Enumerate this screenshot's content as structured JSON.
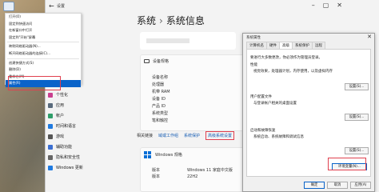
{
  "window": {
    "title": "设置"
  },
  "breadcrumb": {
    "parent": "系统",
    "separator": "›",
    "current": "系统信息"
  },
  "spec": {
    "heading": "设备规格",
    "rows": [
      "设备名称",
      "处理器",
      "机带 RAM",
      "设备 ID",
      "产品 ID",
      "系统类型",
      "笔和触控"
    ]
  },
  "related": {
    "label": "相关链接",
    "links": [
      "域或工作组",
      "系统保护",
      "高级系统设置"
    ]
  },
  "windows": {
    "heading": "Windows 规格",
    "rows": [
      {
        "key": "版本",
        "value": "Windows 11 家庭中文版"
      },
      {
        "key": "版本",
        "value": "22H2"
      }
    ]
  },
  "nav": {
    "items": [
      {
        "label": "个性化",
        "color": "#c9408f"
      },
      {
        "label": "应用",
        "color": "#5a6b7d"
      },
      {
        "label": "帐户",
        "color": "#2f9e6a"
      },
      {
        "label": "时间和语言",
        "color": "#1f7ae0"
      },
      {
        "label": "游戏",
        "color": "#555555"
      },
      {
        "label": "辅助功能",
        "color": "#3b6fd1"
      },
      {
        "label": "隐私和安全性",
        "color": "#666666"
      },
      {
        "label": "Windows 更新",
        "color": "#1f7ae0"
      }
    ]
  },
  "context_menu": {
    "items": [
      "打开(O)",
      "固定到快速访问",
      "在新窗口中打开",
      "固定到\"开始\"屏幕",
      "映射网络驱动器(N)...",
      "断开网络驱动器的连接(C)...",
      "创建快捷方式(S)",
      "删除(D)",
      "重命名(M)",
      "属性(R)"
    ],
    "selected_index": 9
  },
  "dialog": {
    "title": "系统属性",
    "close": "✕",
    "tabs": [
      "计算机名",
      "硬件",
      "高级",
      "系统保护",
      "远程"
    ],
    "active_tab": 2,
    "lines": [
      "要进行大多数更改，你必须作为管理员登录。",
      "性能",
      "视觉效果，处理器计划，内存使用，以及虚拟内存",
      "用户配置文件",
      "与登录帐户相关的桌面设置",
      "启动和故障恢复",
      "系统启动、系统故障和调试信息"
    ],
    "settings_button": "设置(S)...",
    "env_button": "环境变量(N)...",
    "ok": "确定",
    "cancel": "取消",
    "apply": "应用(A)"
  }
}
